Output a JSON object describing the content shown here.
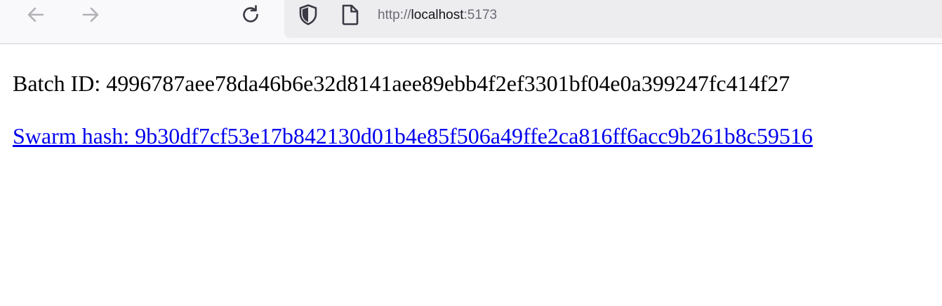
{
  "browser": {
    "url_scheme": "http://",
    "url_host": "localhost",
    "url_port": ":5173",
    "icons": {
      "back": "back-arrow-icon",
      "forward": "forward-arrow-icon",
      "reload": "reload-icon",
      "tracking_protection": "shield-icon",
      "page_info": "page-icon"
    }
  },
  "page": {
    "batch_label": "Batch ID: ",
    "batch_id": "4996787aee78da46b6e32d8141aee89ebb4f2ef3301bf04e0a399247fc414f27",
    "swarm_link_text": "Swarm hash: 9b30df7cf53e17b842130d01b4e85f506a49ffe2ca816ff6acc9b261b8c59516"
  },
  "colors": {
    "toolbar_bg": "#f9f9fb",
    "urlbar_bg": "#ededf0",
    "link": "#0000ee",
    "text": "#000000"
  }
}
